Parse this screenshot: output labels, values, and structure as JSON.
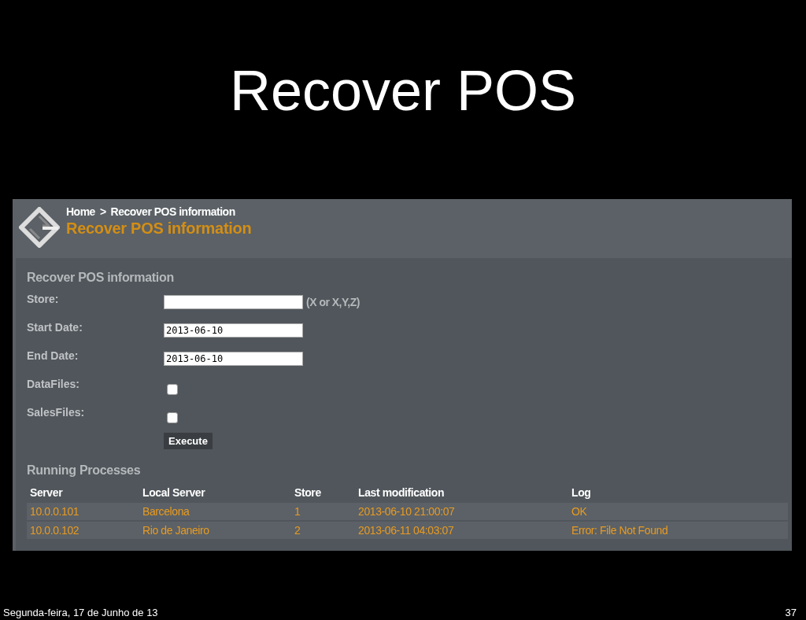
{
  "slide_title": "Recover POS",
  "app": {
    "breadcrumb": [
      {
        "label": "Home"
      },
      {
        "label": "Recover POS information"
      }
    ],
    "breadcrumb_separator": ">",
    "page_title": "Recover POS information",
    "form": {
      "title": "Recover POS information",
      "fields": [
        {
          "kind": "text",
          "label": "Store:",
          "hint": "(X or X,Y,Z)"
        },
        {
          "kind": "text",
          "label": "Start Date:",
          "value": "2013-06-10"
        },
        {
          "kind": "text",
          "label": "End Date:",
          "value": "2013-06-10"
        },
        {
          "kind": "checkbox",
          "label": "DataFiles:",
          "checked": false
        },
        {
          "kind": "checkbox",
          "label": "SalesFiles:",
          "checked": false
        }
      ],
      "button": "Execute"
    },
    "processes": {
      "title": "Running Processes",
      "columns": [
        "Server",
        "Local Server",
        "Store",
        "Last modification",
        "Log"
      ],
      "rows": [
        [
          "10.0.0.101",
          "Barcelona",
          "1",
          "2013-06-10 21:00:07",
          "OK"
        ],
        [
          "10.0.0.102",
          "Rio de Janeiro",
          "2",
          "2013-06-11 04:03:07",
          "Error: File Not Found"
        ]
      ]
    }
  },
  "footer": {
    "date": "Segunda-feira, 17 de Junho de 13",
    "page": "37"
  }
}
